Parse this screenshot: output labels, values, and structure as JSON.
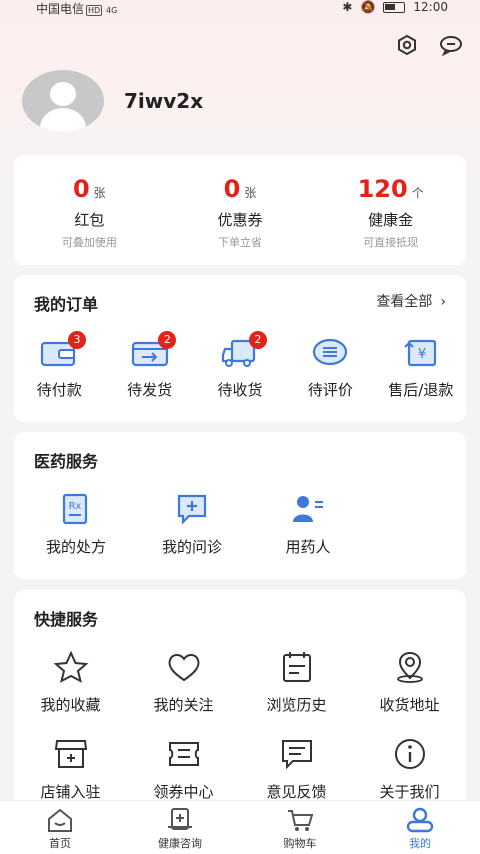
{
  "status_bar": {
    "carrier": "中国电信",
    "hd": "HD",
    "signal": "4G",
    "time": "12:00"
  },
  "profile": {
    "username": "7iwv2x"
  },
  "assets": [
    {
      "value": "0",
      "unit": "张",
      "label": "红包",
      "sub": "可叠加使用"
    },
    {
      "value": "0",
      "unit": "张",
      "label": "优惠券",
      "sub": "下单立省"
    },
    {
      "value": "120",
      "unit": "个",
      "label": "健康金",
      "sub": "可直接抵现"
    }
  ],
  "orders": {
    "title": "我的订单",
    "view_all": "查看全部",
    "items": [
      {
        "label": "待付款",
        "badge": "3",
        "icon": "wallet-icon"
      },
      {
        "label": "待发货",
        "badge": "2",
        "icon": "package-send-icon"
      },
      {
        "label": "待收货",
        "badge": "2",
        "icon": "delivery-truck-icon"
      },
      {
        "label": "待评价",
        "badge": "",
        "icon": "comment-icon"
      },
      {
        "label": "售后/退款",
        "badge": "",
        "icon": "refund-icon"
      }
    ]
  },
  "medical": {
    "title": "医药服务",
    "items": [
      {
        "label": "我的处方",
        "icon": "prescription-icon"
      },
      {
        "label": "我的问诊",
        "icon": "consultation-icon"
      },
      {
        "label": "用药人",
        "icon": "patient-icon"
      }
    ]
  },
  "quick": {
    "title": "快捷服务",
    "items": [
      {
        "label": "我的收藏",
        "icon": "star-icon"
      },
      {
        "label": "我的关注",
        "icon": "heart-icon"
      },
      {
        "label": "浏览历史",
        "icon": "history-icon"
      },
      {
        "label": "收货地址",
        "icon": "location-icon"
      },
      {
        "label": "店铺入驻",
        "icon": "store-icon"
      },
      {
        "label": "领券中心",
        "icon": "coupon-icon"
      },
      {
        "label": "意见反馈",
        "icon": "feedback-icon"
      },
      {
        "label": "关于我们",
        "icon": "info-icon"
      }
    ]
  },
  "bottom_nav": [
    {
      "label": "首页",
      "icon": "home-icon"
    },
    {
      "label": "健康咨询",
      "icon": "health-consult-icon"
    },
    {
      "label": "购物车",
      "icon": "cart-icon"
    },
    {
      "label": "我的",
      "icon": "profile-icon",
      "active": true
    }
  ],
  "colors": {
    "accent": "#e2231a",
    "blue": "#3e78d8"
  }
}
